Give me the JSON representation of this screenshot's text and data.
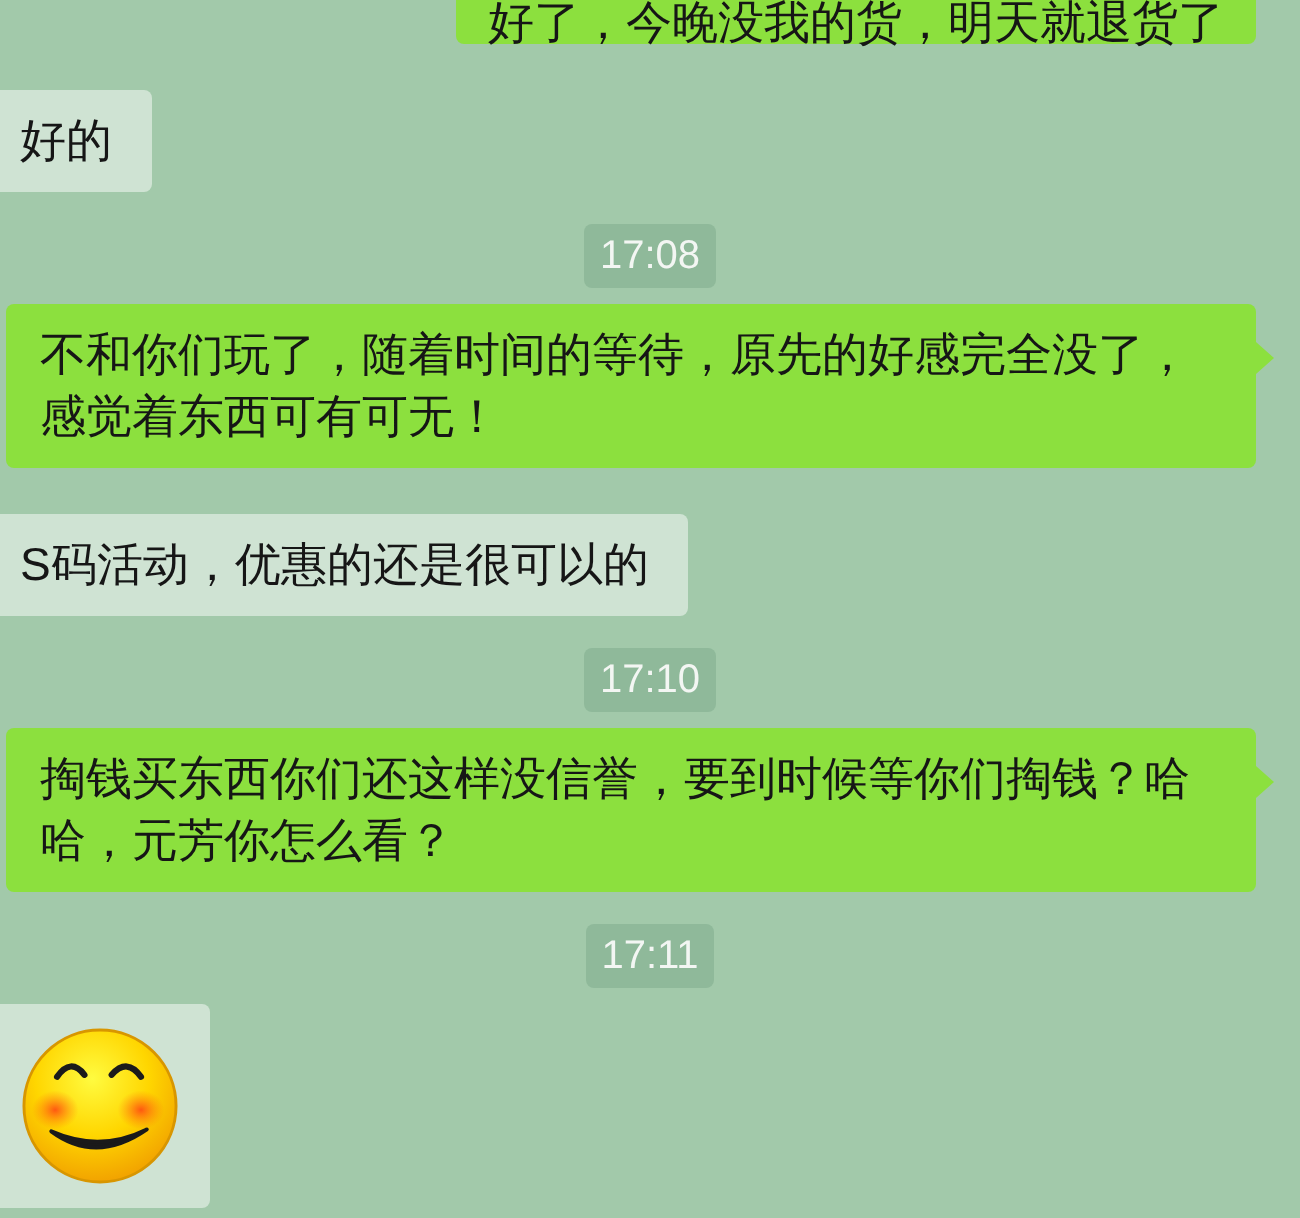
{
  "messages": [
    {
      "kind": "text",
      "outgoing": true,
      "cut_off": true,
      "text": "好了，今晚没我的货，明天就退货了"
    },
    {
      "kind": "text",
      "outgoing": false,
      "text": "好的"
    },
    {
      "kind": "time",
      "text": "17:08"
    },
    {
      "kind": "text",
      "outgoing": true,
      "text": "不和你们玩了，随着时间的等待，原先的好感完全没了，感觉着东西可有可无！"
    },
    {
      "kind": "text",
      "outgoing": false,
      "text": "S码活动，优惠的还是很可以的"
    },
    {
      "kind": "time",
      "text": "17:10"
    },
    {
      "kind": "text",
      "outgoing": true,
      "text": "掏钱买东西你们还这样没信誉，要到时候等你们掏钱？哈哈，元芳你怎么看？"
    },
    {
      "kind": "time",
      "text": "17:11"
    },
    {
      "kind": "sticker",
      "outgoing": false
    }
  ]
}
